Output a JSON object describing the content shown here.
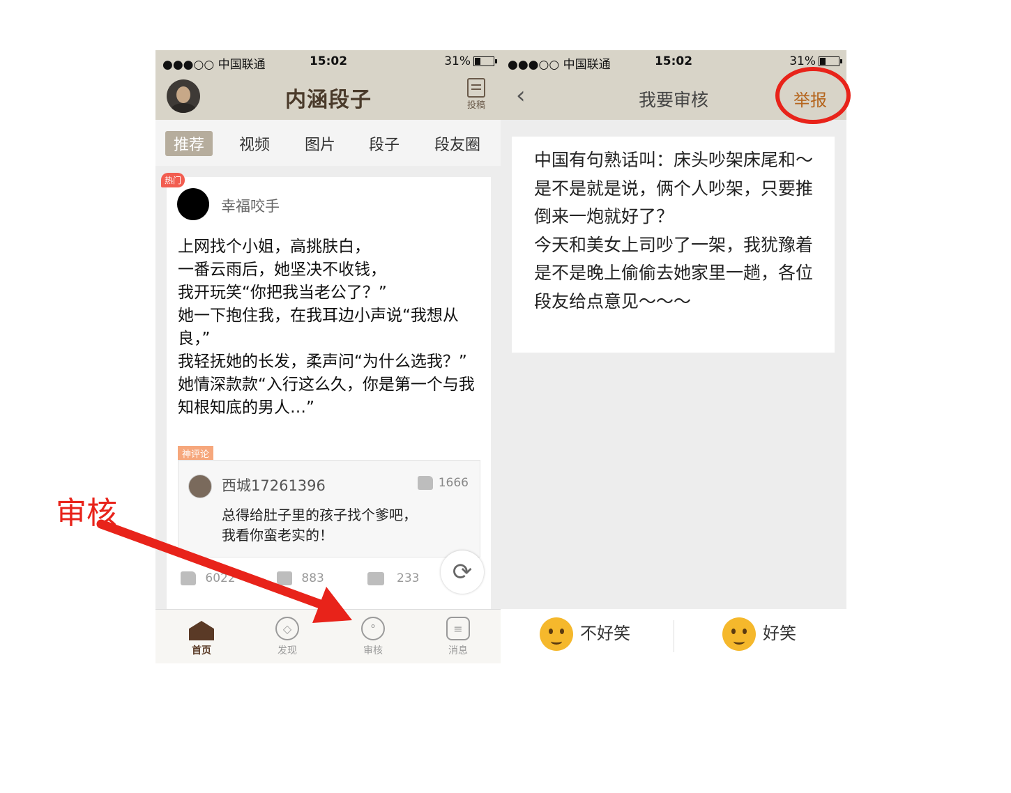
{
  "status_bar": {
    "carrier": "●●●○○ 中国联通",
    "time": "15:02",
    "battery": "31%"
  },
  "left": {
    "app_title": "内涵段子",
    "post_label": "投稿",
    "tabs": [
      {
        "label": "推荐",
        "active": true
      },
      {
        "label": "视频"
      },
      {
        "label": "图片"
      },
      {
        "label": "段子"
      },
      {
        "label": "段友圈"
      }
    ],
    "hot_badge": "热门",
    "author": "幸福咬手",
    "joke": "上网找个小姐，高挑肤白，\n一番云雨后，她坚决不收钱，\n我开玩笑“你把我当老公了？”\n她一下抱住我，在我耳边小声说“我想从良，”\n我轻抚她的长发，柔声问“为什么选我？”\n她情深款款“入行这么久，你是第一个与我知根知底的男人…”",
    "god_comment_label": "神评论",
    "comment": {
      "user": "西城17261396",
      "likes": "1666",
      "text": "总得给肚子里的孩子找个爹吧，\n我看你蛮老实的！"
    },
    "actions": {
      "likes": "6022",
      "dislikes": "883",
      "comments": "233"
    },
    "bottom_nav": [
      {
        "label": "首页",
        "icon": "home-icon",
        "active": true
      },
      {
        "label": "发现",
        "icon": "compass-icon"
      },
      {
        "label": "审核",
        "icon": "review-icon"
      },
      {
        "label": "消息",
        "icon": "message-icon"
      }
    ]
  },
  "right": {
    "title": "我要审核",
    "report_label": "举报",
    "review_text": "中国有句熟话叫：床头吵架床尾和～\n是不是就是说，俩个人吵架，只要推倒来一炮就好了？\n今天和美女上司吵了一架，我犹豫着是不是晚上偷偷去她家里一趟，各位段友给点意见～～～",
    "vote_not_funny": "不好笑",
    "vote_funny": "好笑"
  },
  "annotation": {
    "label": "审核",
    "color": "#e8231a"
  }
}
